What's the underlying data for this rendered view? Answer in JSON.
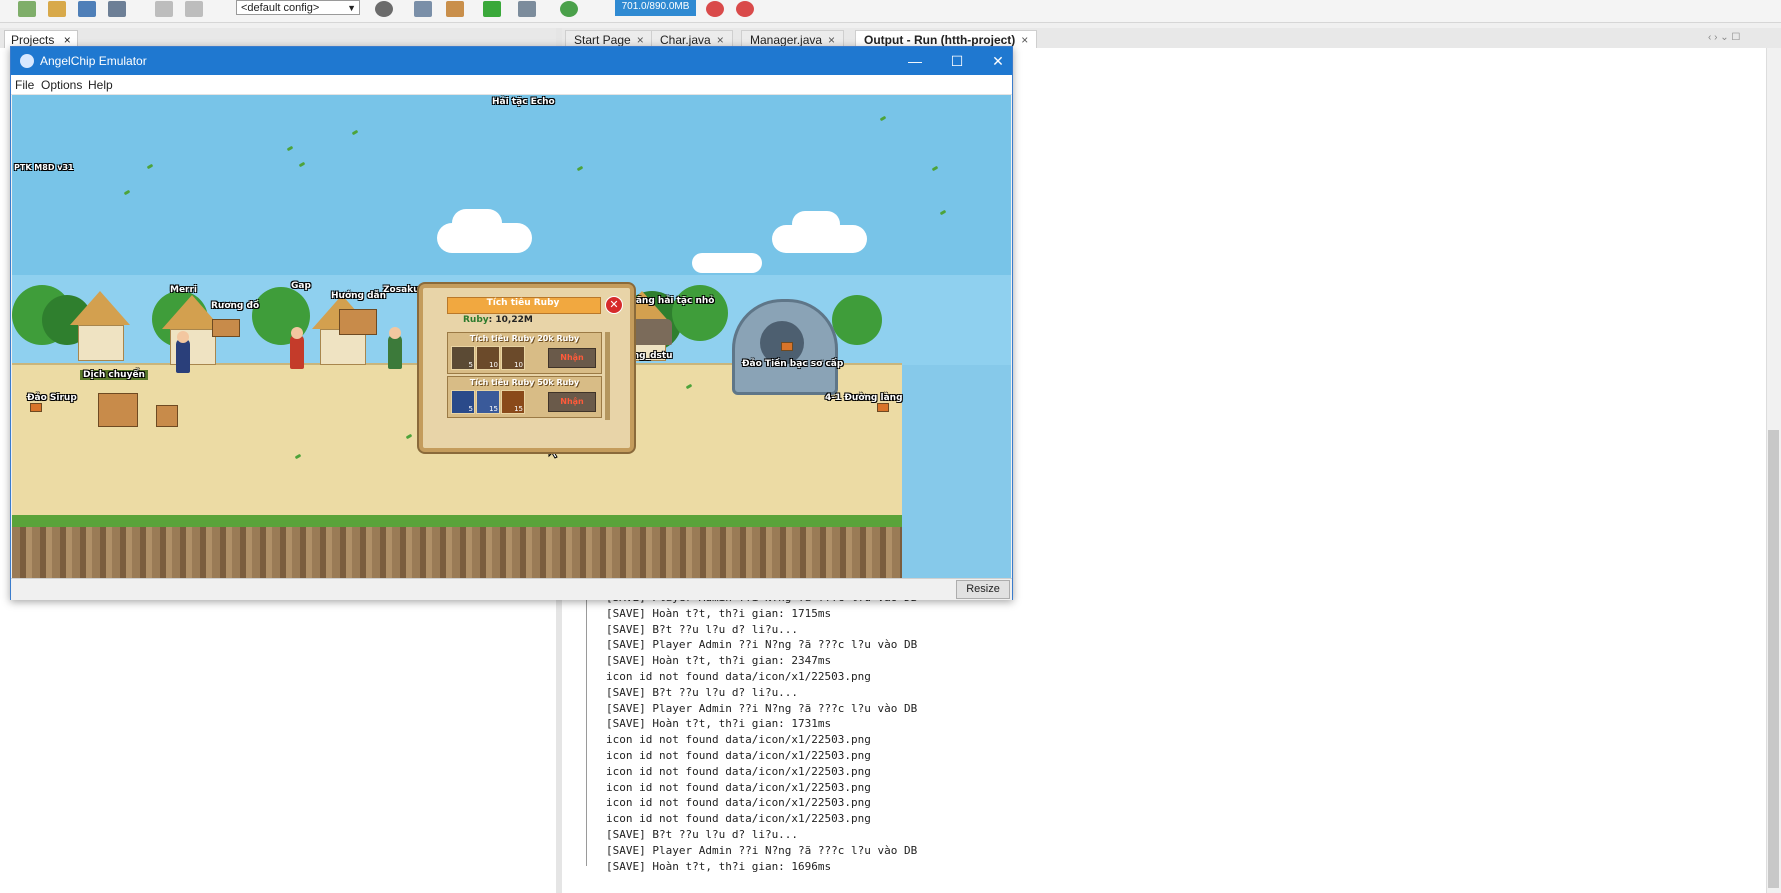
{
  "ide": {
    "config": "<default config>",
    "memory": "701.0/890.0MB",
    "projects_tab": "Projects",
    "tabs": [
      {
        "label": "Start Page"
      },
      {
        "label": "Char.java"
      },
      {
        "label": "Manager.java"
      },
      {
        "label": "Output - Run (htth-project)",
        "active": true
      }
    ],
    "output_lines": [
      "[SAVE] Player Admin ??i N?ng ?ã ???c l?u vào DB",
      "[SAVE] Hoàn t?t, th?i gian: 1715ms",
      "[SAVE] B?t ??u l?u d? li?u...",
      "[SAVE] Player Admin ??i N?ng ?ã ???c l?u vào DB",
      "[SAVE] Hoàn t?t, th?i gian: 2347ms",
      "icon id not found data/icon/x1/22503.png",
      "[SAVE] B?t ??u l?u d? li?u...",
      "[SAVE] Player Admin ??i N?ng ?ã ???c l?u vào DB",
      "[SAVE] Hoàn t?t, th?i gian: 1731ms",
      "icon id not found data/icon/x1/22503.png",
      "icon id not found data/icon/x1/22503.png",
      "icon id not found data/icon/x1/22503.png",
      "icon id not found data/icon/x1/22503.png",
      "icon id not found data/icon/x1/22503.png",
      "icon id not found data/icon/x1/22503.png",
      "[SAVE] B?t ??u l?u d? li?u...",
      "[SAVE] Player Admin ??i N?ng ?ã ???c l?u vào DB",
      "[SAVE] Hoàn t?t, th?i gian: 1696ms"
    ]
  },
  "emulator": {
    "title": "AngelChip Emulator",
    "menu": [
      "File",
      "Options",
      "Help"
    ],
    "resize": "Resize",
    "controls": {
      "minimize": "—",
      "maximize": "☐",
      "close": "✕"
    }
  },
  "game": {
    "top_label": "Hải tặc Echo",
    "version": "PTK M8D v31",
    "npcs": [
      "Merri",
      "Rương đồ",
      "Gap",
      "Hướng dẫn",
      "Zosaku",
      "Băng hải tặc nhỏ",
      "Dịch chuyển",
      "Đảo Sirup",
      "Hồng_dstu",
      "Đảo Tiền bạc sơ cấp",
      "4-1 Đường làng"
    ],
    "popup": {
      "title": "Tích tiêu Ruby",
      "amount_label": "Ruby",
      "amount": ": 10,22M",
      "rows": [
        {
          "title": "Tích tiêu Ruby 20k Ruby",
          "items": [
            "5",
            "10",
            "10"
          ],
          "claim": "Nhận"
        },
        {
          "title": "Tích tiêu Ruby 50k Ruby",
          "items": [
            "5",
            "15",
            "15"
          ],
          "claim": "Nhận"
        }
      ],
      "close": "✕"
    }
  }
}
